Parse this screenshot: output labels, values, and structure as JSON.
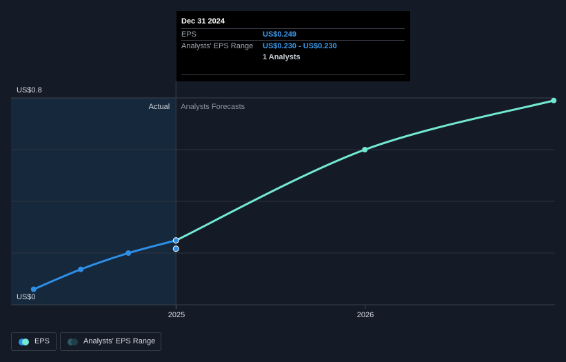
{
  "tooltip": {
    "date": "Dec 31 2024",
    "rows": [
      {
        "label": "EPS",
        "value": "US$0.249"
      },
      {
        "label": "Analysts' EPS Range",
        "value": "US$0.230 - US$0.230"
      },
      {
        "label": "",
        "value": "1 Analysts"
      }
    ]
  },
  "legend": {
    "eps_label": "EPS",
    "range_label": "Analysts' EPS Range"
  },
  "colors": {
    "background": "#151b26",
    "actual_line": "#2e8fe6",
    "forecast_line": "#73e8d3",
    "actual_region": "#16283c",
    "grid": "#2c333e",
    "range_dot": "#2c5a66"
  },
  "chart_data": {
    "type": "line",
    "title": "",
    "xlabel": "",
    "ylabel": "",
    "ylim": [
      0,
      0.8
    ],
    "y_tick_labels": [
      "US$0.8",
      "US$0"
    ],
    "x_tick_labels": [
      "2025",
      "2026"
    ],
    "region_labels": {
      "actual": "Actual",
      "forecast": "Analysts Forecasts"
    },
    "grid": true,
    "legend_position": "bottom-left",
    "series": [
      {
        "name": "EPS",
        "kind": "actual",
        "points": [
          {
            "x": "2024-03-31",
            "y": 0.06
          },
          {
            "x": "2024-06-30",
            "y": 0.137
          },
          {
            "x": "2024-09-30",
            "y": 0.2
          },
          {
            "x": "2024-12-31",
            "y": 0.249
          }
        ]
      },
      {
        "name": "Analysts' EPS Range",
        "kind": "forecast",
        "points": [
          {
            "x": "2024-12-31",
            "y": 0.249
          },
          {
            "x": "2025-12-31",
            "y": 0.6
          },
          {
            "x": "2026-12-31",
            "y": 0.79
          }
        ]
      }
    ],
    "range_points": [
      {
        "x": "2024-12-31",
        "low": 0.23,
        "high": 0.23
      }
    ]
  }
}
